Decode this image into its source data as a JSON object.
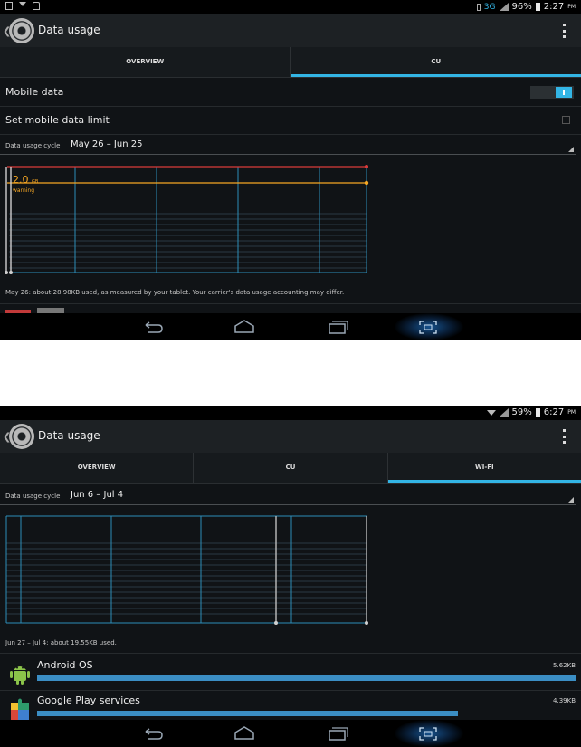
{
  "screens": [
    {
      "status": {
        "network": "3G",
        "battery": "96%",
        "time": "2:27",
        "ampm": "PM"
      },
      "actionbar": {
        "title": "Data usage"
      },
      "tabs": [
        {
          "label": "OVERVIEW",
          "active": false
        },
        {
          "label": "CU",
          "active": true
        }
      ],
      "mobile_data": {
        "label": "Mobile data",
        "enabled": true
      },
      "set_limit": {
        "label": "Set mobile data limit",
        "checked": false
      },
      "cycle": {
        "label": "Data usage cycle",
        "value": "May 26 – Jun 25"
      },
      "chart": {
        "warning_value": "2.0",
        "warning_unit": "GB",
        "warning_label": "warning",
        "limit_color": "#d93b3b",
        "warning_color": "#f5a623",
        "grid_color": "#33b5e5"
      },
      "note": "May 26: about 28.98KB used, as measured by your tablet. Your carrier's data usage accounting may differ."
    },
    {
      "status": {
        "battery": "59%",
        "time": "6:27",
        "ampm": "PM"
      },
      "actionbar": {
        "title": "Data usage"
      },
      "tabs": [
        {
          "label": "OVERVIEW",
          "active": false
        },
        {
          "label": "CU",
          "active": false
        },
        {
          "label": "WI-FI",
          "active": true
        }
      ],
      "cycle": {
        "label": "Data usage cycle",
        "value": "Jun 6 – Jul 4"
      },
      "note": "Jun 27 – Jul 4: about 19.55KB used.",
      "apps": [
        {
          "name": "Android OS",
          "size": "5.62KB",
          "usage_fraction": 1.0,
          "icon": "android-icon"
        },
        {
          "name": "Google Play services",
          "size": "4.39KB",
          "usage_fraction": 0.78,
          "icon": "puzzle-icon"
        }
      ]
    }
  ]
}
